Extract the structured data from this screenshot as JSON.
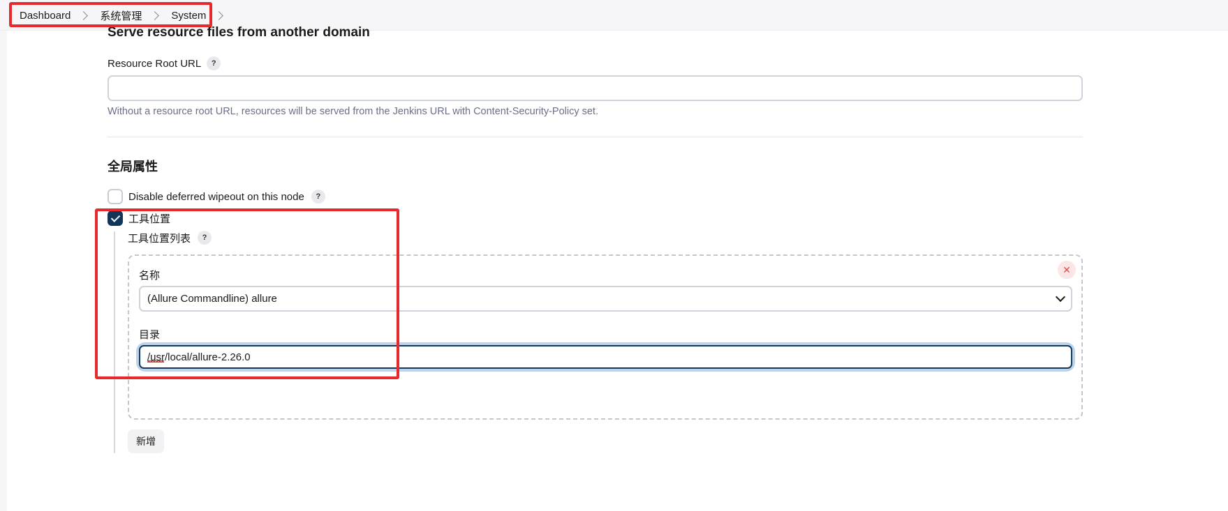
{
  "breadcrumb": {
    "items": [
      "Dashboard",
      "系统管理",
      "System"
    ]
  },
  "resource_section": {
    "title": "Serve resource files from another domain",
    "field_label": "Resource Root URL",
    "help_glyph": "?",
    "field_value": "",
    "help_text": "Without a resource root URL, resources will be served from the Jenkins URL with Content-Security-Policy set."
  },
  "global_section": {
    "title": "全局属性",
    "disable_wipeout": {
      "label": "Disable deferred wipeout on this node",
      "checked": false
    },
    "tool_locations": {
      "label": "工具位置",
      "checked": true,
      "list_label": "工具位置列表",
      "entries": [
        {
          "name_label": "名称",
          "name_value": "(Allure Commandline) allure",
          "dir_label": "目录",
          "dir_value": "/usr/local/allure-2.26.0",
          "delete_glyph": "✕"
        }
      ],
      "add_label": "新增"
    }
  },
  "colors": {
    "annotation": "#e8282b",
    "checkbox_checked": "#12365a",
    "help_text": "#6b6f86",
    "focus_ring": "#bcd3ea"
  }
}
